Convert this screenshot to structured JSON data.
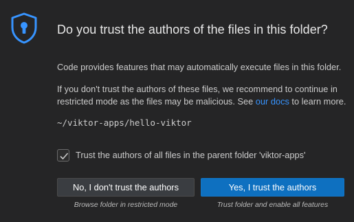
{
  "dialog": {
    "title": "Do you trust the authors of the files in this folder?",
    "message_1": "Code provides features that may automatically execute files in this folder.",
    "message_2_line1": "If you don't trust the authors of these files, we recommend to continue in",
    "message_2_line2_pre": "restricted mode as the files may be malicious. See ",
    "message_2_link": "our docs",
    "message_2_line2_post": " to learn more.",
    "folder_path": "~/viktor-apps/hello-viktor",
    "checkbox": {
      "label": "Trust the authors of all files in the parent folder 'viktor-apps'",
      "checked": true
    },
    "buttons": {
      "no_label": "No, I don't trust the authors",
      "no_caption": "Browse folder in restricted mode",
      "yes_label": "Yes, I trust the authors",
      "yes_caption": "Trust folder and enable all features"
    },
    "icon": "shield-lock-icon"
  },
  "colors": {
    "background": "#252526",
    "accent": "#3794ff",
    "primary_button": "#0e70c0",
    "secondary_button": "#3a3d41"
  }
}
